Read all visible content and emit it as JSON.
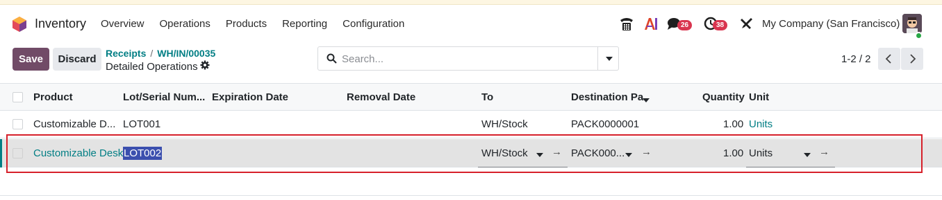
{
  "app": {
    "name": "Inventory"
  },
  "menu": [
    "Overview",
    "Operations",
    "Products",
    "Reporting",
    "Configuration"
  ],
  "systray": {
    "messages_badge": "26",
    "activities_badge": "38",
    "company": "My Company (San Francisco)"
  },
  "control": {
    "save_label": "Save",
    "discard_label": "Discard",
    "breadcrumb": [
      "Receipts",
      "WH/IN/00035"
    ],
    "subtitle": "Detailed Operations",
    "search_placeholder": "Search...",
    "pager": "1-2 / 2"
  },
  "table": {
    "columns": [
      "Product",
      "Lot/Serial Num...",
      "Expiration Date",
      "Removal Date",
      "To",
      "Destination Pa.",
      "Quantity",
      "Unit"
    ],
    "rows": [
      {
        "product": "Customizable D...",
        "lot": "LOT001",
        "expiration": "",
        "removal": "",
        "to": "WH/Stock",
        "package": "PACK0000001",
        "quantity": "1.00",
        "unit": "Units"
      },
      {
        "product": "Customizable Desk",
        "lot": "LOT002",
        "expiration": "",
        "removal": "",
        "to": "WH/Stock",
        "package": "PACK000...",
        "quantity": "1.00",
        "unit": "Units"
      }
    ]
  },
  "colors": {
    "brand": "#714b67",
    "link": "#017e84",
    "badge": "#d9354f",
    "highlight": "#d6202a"
  }
}
